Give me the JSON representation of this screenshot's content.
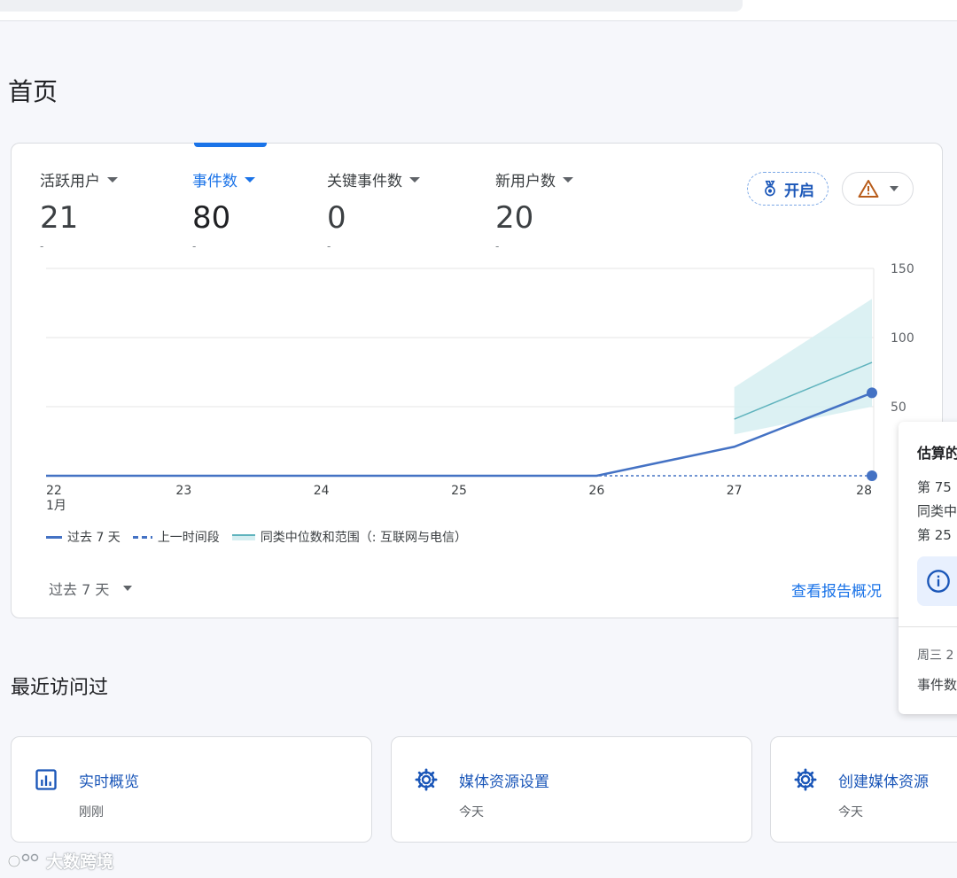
{
  "page": {
    "title": "首页"
  },
  "metrics": [
    {
      "label": "活跃用户",
      "value": "21",
      "delta": "-",
      "active": false
    },
    {
      "label": "事件数",
      "value": "80",
      "delta": "-",
      "active": true
    },
    {
      "label": "关键事件数",
      "value": "0",
      "delta": "-",
      "active": false
    },
    {
      "label": "新用户数",
      "value": "20",
      "delta": "-",
      "active": false
    }
  ],
  "header_actions": {
    "open_label": "开启"
  },
  "chart_data": {
    "type": "line",
    "x": [
      "22",
      "23",
      "24",
      "25",
      "26",
      "27",
      "28"
    ],
    "x_sublabel": "1月",
    "ylim": [
      0,
      150
    ],
    "y_ticks": [
      "150",
      "100",
      "50"
    ],
    "grid": true,
    "series": [
      {
        "name": "过去 7 天",
        "style": "solid",
        "values": [
          0,
          0,
          0,
          0,
          0,
          21,
          60
        ]
      },
      {
        "name": "上一时间段",
        "style": "dashed",
        "values": [
          0,
          0,
          0,
          0,
          0,
          0,
          0
        ]
      },
      {
        "name": "同类中位数和范围（: 互联网与电信）",
        "style": "median-range",
        "median": [
          null,
          null,
          null,
          null,
          null,
          41,
          82
        ],
        "range_low": [
          null,
          null,
          null,
          null,
          null,
          30,
          50
        ],
        "range_high": [
          null,
          null,
          null,
          null,
          null,
          64,
          128
        ]
      }
    ],
    "colors": {
      "current": "#4472c4",
      "median": "#5fb3bd",
      "range": "#d6eef1",
      "grid": "#e6e6e6"
    }
  },
  "footer": {
    "period_label": "过去 7 天",
    "view_report": "查看报告概况"
  },
  "tooltip": {
    "title": "估算的",
    "lines": [
      "第 75",
      "同类中",
      "第 25"
    ],
    "date": "周三 2",
    "metric": "事件数"
  },
  "recent": {
    "title": "最近访问过",
    "items": [
      {
        "title": "实时概览",
        "time": "刚刚",
        "icon": "bar-chart-icon"
      },
      {
        "title": "媒体资源设置",
        "time": "今天",
        "icon": "gear-icon"
      },
      {
        "title": "创建媒体资源",
        "time": "今天",
        "icon": "gear-icon"
      }
    ]
  },
  "watermark": {
    "text": "大数跨境"
  }
}
